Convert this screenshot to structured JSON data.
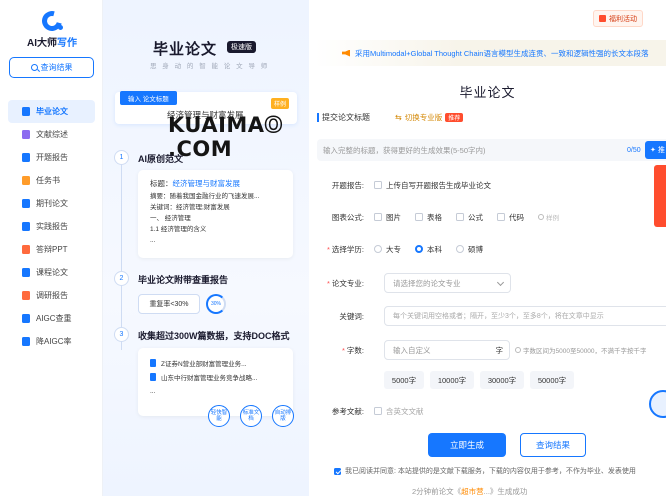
{
  "sidebar": {
    "logo": {
      "prefix": "AI大师",
      "suffix": "写作"
    },
    "query_button": "查询结果",
    "items": [
      {
        "label": "毕业论文",
        "icon": "thesis-icon",
        "color": "#1677ff",
        "active": true
      },
      {
        "label": "文献综述",
        "icon": "literature-review-icon",
        "color": "#8c6cf0"
      },
      {
        "label": "开题报告",
        "icon": "proposal-report-icon",
        "color": "#1677ff"
      },
      {
        "label": "任务书",
        "icon": "task-book-icon",
        "color": "#ff9c2a"
      },
      {
        "label": "期刊论文",
        "icon": "journal-paper-icon",
        "color": "#1677ff"
      },
      {
        "label": "实践报告",
        "icon": "practice-report-icon",
        "color": "#1677ff"
      },
      {
        "label": "答辩PPT",
        "icon": "defense-ppt-icon",
        "color": "#ff6a3d"
      },
      {
        "label": "课程论文",
        "icon": "course-paper-icon",
        "color": "#1677ff"
      },
      {
        "label": "调研报告",
        "icon": "research-report-icon",
        "color": "#ff6a3d"
      },
      {
        "label": "AIGC查重",
        "icon": "aigc-check-icon",
        "color": "#1677ff"
      },
      {
        "label": "降AIGC率",
        "icon": "reduce-aigc-icon",
        "color": "#1677ff"
      }
    ]
  },
  "promo": {
    "title": "毕业论文",
    "badge": "极速版",
    "subtitle": "思 身 动 的 智 能 论 文 导 师",
    "input_tag": "输入 论文标题",
    "input_text": "经济管理与财富发展",
    "sample_tag": "样例",
    "watermark": {
      "pre": "KUAIMA",
      "o": "O",
      "post": ".COM"
    },
    "steps": [
      {
        "num": "1",
        "title": "AI原创范文"
      },
      {
        "num": "2",
        "title": "毕业论文附带查重报告"
      },
      {
        "num": "3",
        "title": "收集超过300W篇数据，支持DOC格式"
      }
    ],
    "card1": {
      "title_label": "标题：",
      "title_value": "经济管理与财富发展",
      "abstract": "摘要：随着我国金融行业的飞速发展...",
      "keywords": "关键词：经济管理;财富发展",
      "outline1": "一、 经济管理",
      "outline2": "1.1 经济管理的含义",
      "more": "..."
    },
    "dup_rate": "重复率<30%",
    "dup_ring": "30%",
    "docs": [
      "Z证券N营业部财富管理业务...",
      "山东中行财富管理业务竞争战略..."
    ],
    "docs_more": "...",
    "features": [
      "轻快智能",
      "标准文档",
      "自动排版"
    ]
  },
  "main": {
    "welfare": "福利活动",
    "notice": "采用Multimodal+Global Thought Chain语言模型生成连贯、一致和逻辑性强的长文本段落",
    "title": "毕业论文",
    "title_label": "提交论文标题",
    "switch_pro": "切换专业版",
    "recommend": "推荐",
    "title_placeholder": "输入完整的标题，获得更好的生成效果(5-50字内)",
    "title_count": "0/50",
    "gen_title_btn": "推",
    "proposal_label": "开题报告:",
    "proposal_option": "上传自写开题报告生成毕业论文",
    "figure_label": "图表公式:",
    "figure_options": [
      "图片",
      "表格",
      "公式",
      "代码"
    ],
    "figure_extra": "样例",
    "degree_label": "选择学历:",
    "degree_options": [
      "大专",
      "本科",
      "硕博"
    ],
    "degree_selected": 1,
    "major_label": "论文专业:",
    "major_placeholder": "请选择您的论文专业",
    "keyword_label": "关键词:",
    "keyword_placeholder": "每个关键词用空格或者；隔开，至少3个，至多8个，将在文章中显示",
    "words_label": "字数:",
    "words_placeholder": "输入自定义",
    "words_unit": "字",
    "words_hint": "字数区间为5000至50000，不满千字按千字",
    "words_chips": [
      "5000字",
      "10000字",
      "30000字",
      "50000字"
    ],
    "reference_label": "参考文献:",
    "reference_option": "含英文文献",
    "generate_btn": "立即生成",
    "query_btn": "查询结果",
    "agree_text": "我已阅读并同意: 本站提供的是文献下载服务，下载的内容仅用于参考，不作为毕业、发表使用",
    "bottom_tip_pre": "2分钟前论文《",
    "bottom_tip_hl": "超市营",
    "bottom_tip_post": "...》生成成功"
  }
}
